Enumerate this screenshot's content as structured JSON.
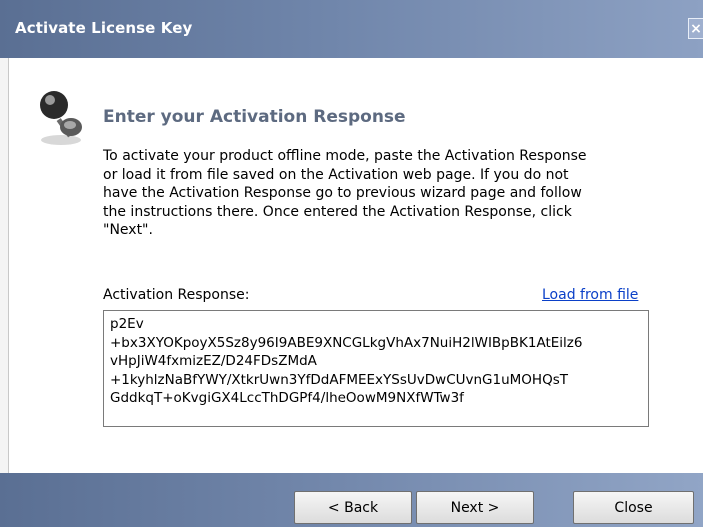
{
  "window": {
    "title": "Activate License Key",
    "close_glyph": "×"
  },
  "page": {
    "icon": "pushpin-icon",
    "heading": "Enter your Activation Response",
    "description": "To activate your product offline mode, paste the Activation Response\nor load it from file saved on the Activation web page. If you do not\nhave the Activation Response go to previous wizard page and follow\nthe instructions there. Once entered the Activation Response, click\n\"Next\"."
  },
  "activation": {
    "label": "Activation Response:",
    "load_link": "Load from file",
    "value": "p2Ev\n+bx3XYOKpoyX5Sz8y96I9ABE9XNCGLkgVhAx7NuiH2lWIBpBK1AtEilz6\nvHpJiW4fxmizEZ/D24FDsZMdA\n+1kyhlzNaBfYWY/XtkrUwn3YfDdAFMEExYSsUvDwCUvnG1uMOHQsT\nGddkqT+oKvgiGX4LccThDGPf4/lheOowM9NXfWTw3f"
  },
  "buttons": {
    "back": "< Back",
    "next": "Next >",
    "close": "Close"
  }
}
